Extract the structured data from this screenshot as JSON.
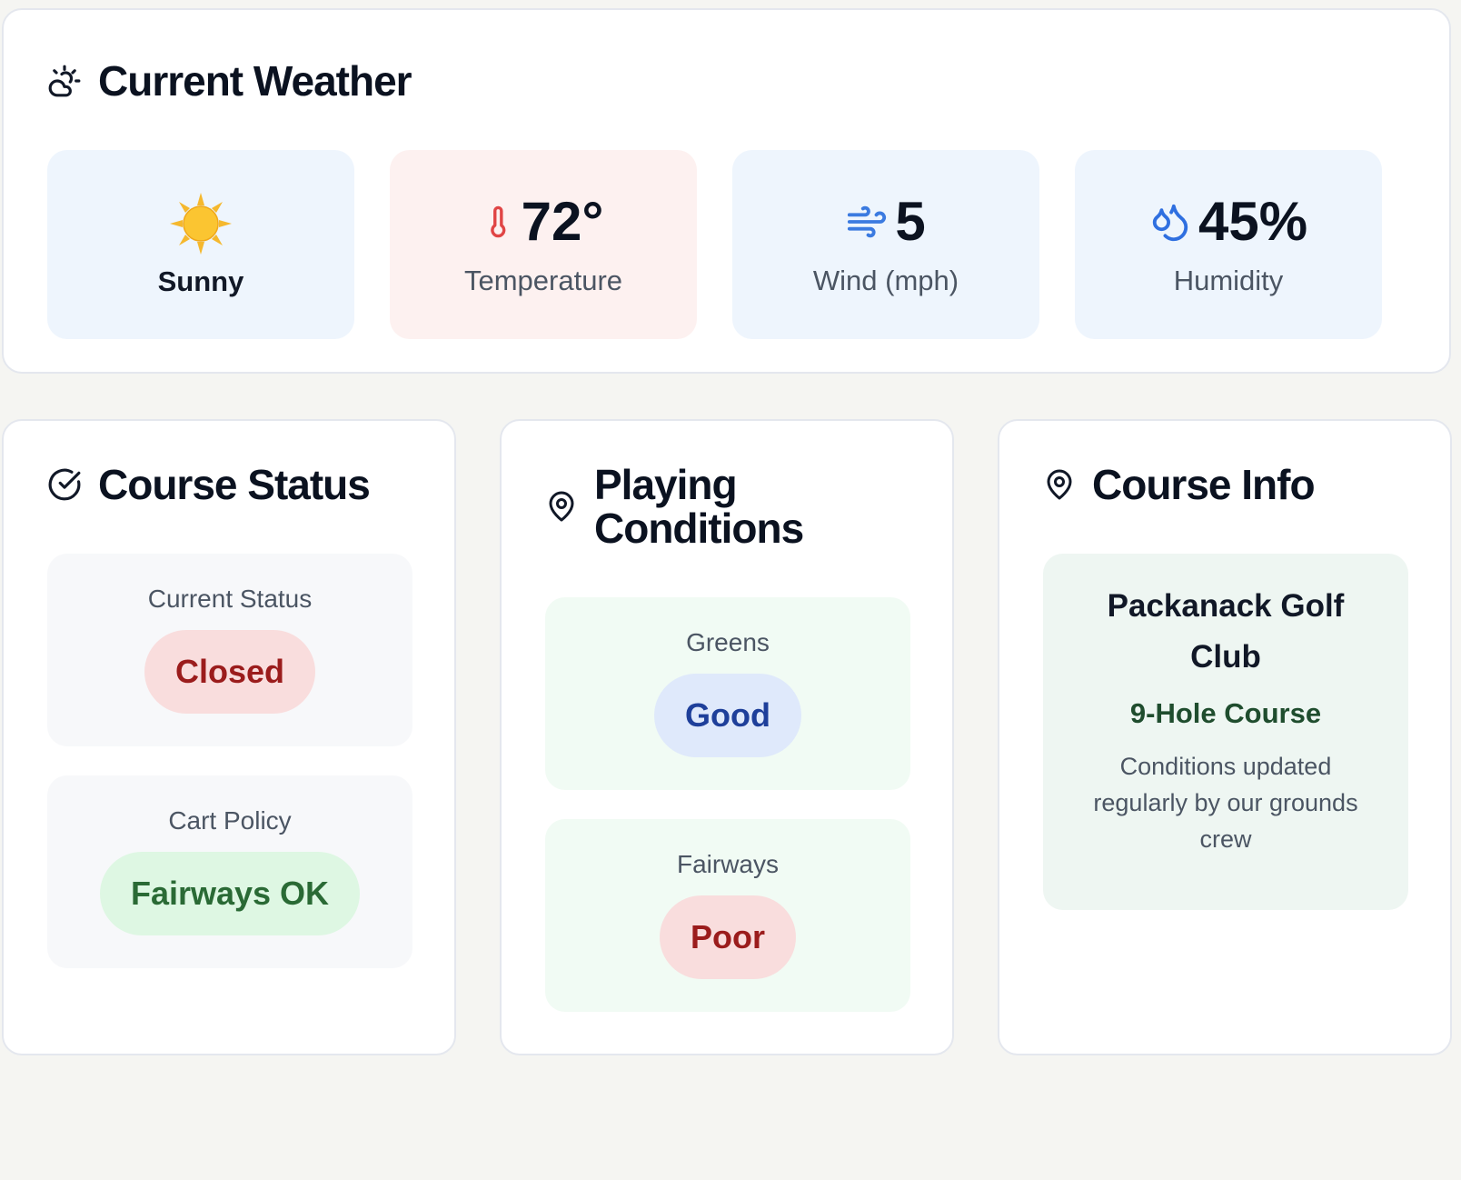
{
  "weather": {
    "title": "Current Weather",
    "condition": {
      "label": "Sunny",
      "icon": "sun-icon"
    },
    "temperature": {
      "value": "72°",
      "label": "Temperature",
      "icon": "thermometer-icon"
    },
    "wind": {
      "value": "5",
      "label": "Wind (mph)",
      "icon": "wind-icon"
    },
    "humidity": {
      "value": "45%",
      "label": "Humidity",
      "icon": "droplets-icon"
    }
  },
  "course_status": {
    "title": "Course Status",
    "current_status": {
      "label": "Current Status",
      "value": "Closed"
    },
    "cart_policy": {
      "label": "Cart Policy",
      "value": "Fairways OK"
    }
  },
  "playing_conditions": {
    "title": "Playing Conditions",
    "greens": {
      "label": "Greens",
      "value": "Good"
    },
    "fairways": {
      "label": "Fairways",
      "value": "Poor"
    }
  },
  "course_info": {
    "title": "Course Info",
    "club_name": "Packanack Golf Club",
    "course_type": "9-Hole Course",
    "note": "Conditions updated regularly by our grounds crew"
  },
  "colors": {
    "page_bg": "#f5f5f2",
    "status_red": "#9b1c1c",
    "status_green": "#2a6a35",
    "status_blue": "#1e3f9a"
  }
}
